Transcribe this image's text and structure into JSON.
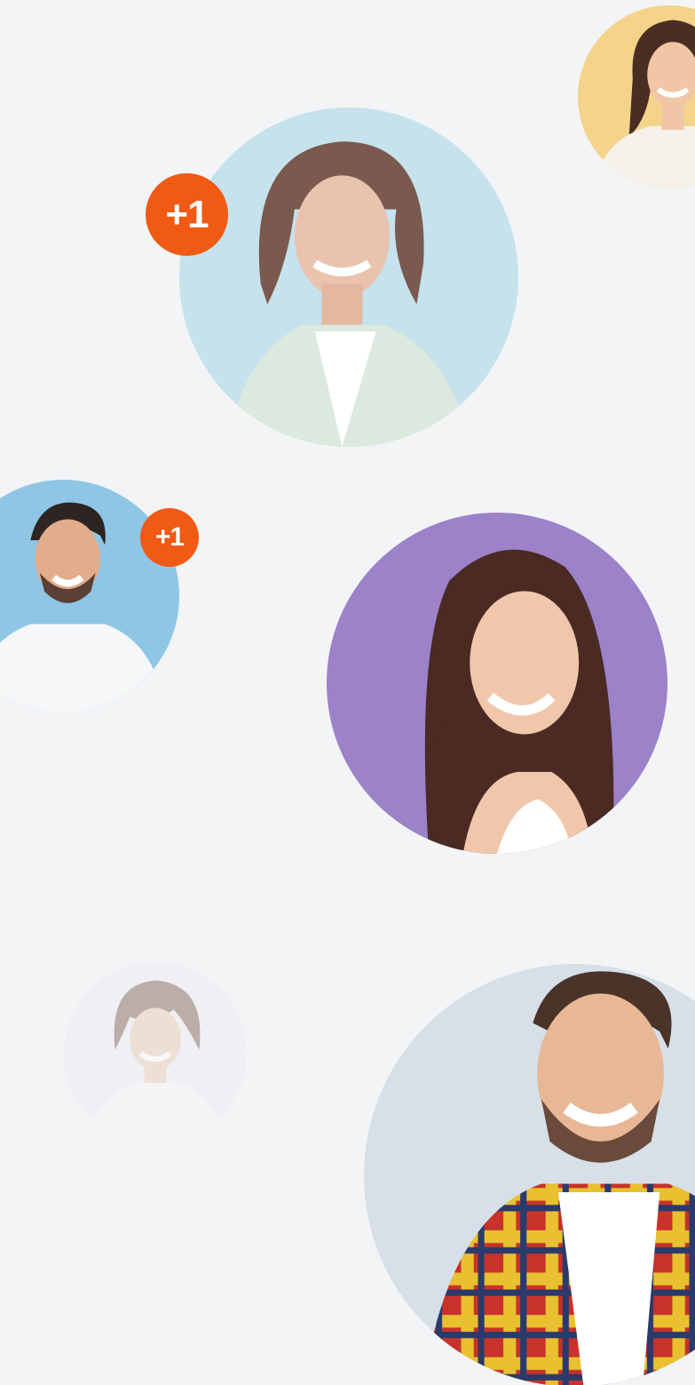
{
  "colors": {
    "background": "#f3f4f6",
    "badge": "#f05a14"
  },
  "badges": [
    {
      "text": "+1"
    },
    {
      "text": "+1"
    }
  ],
  "avatars": [
    {
      "icon": "woman-yellow-avatar-icon",
      "bg": "#f3d48a"
    },
    {
      "icon": "older-woman-blue-avatar-icon",
      "bg": "#c6e2ec"
    },
    {
      "icon": "man-blue-avatar-icon",
      "bg": "#8fc6e6"
    },
    {
      "icon": "woman-purple-avatar-icon",
      "bg": "#9b82c9"
    },
    {
      "icon": "woman-faded-avatar-icon",
      "bg": "#e9ecef"
    },
    {
      "icon": "man-plaid-avatar-icon",
      "bg": "#d7dfe8"
    }
  ]
}
